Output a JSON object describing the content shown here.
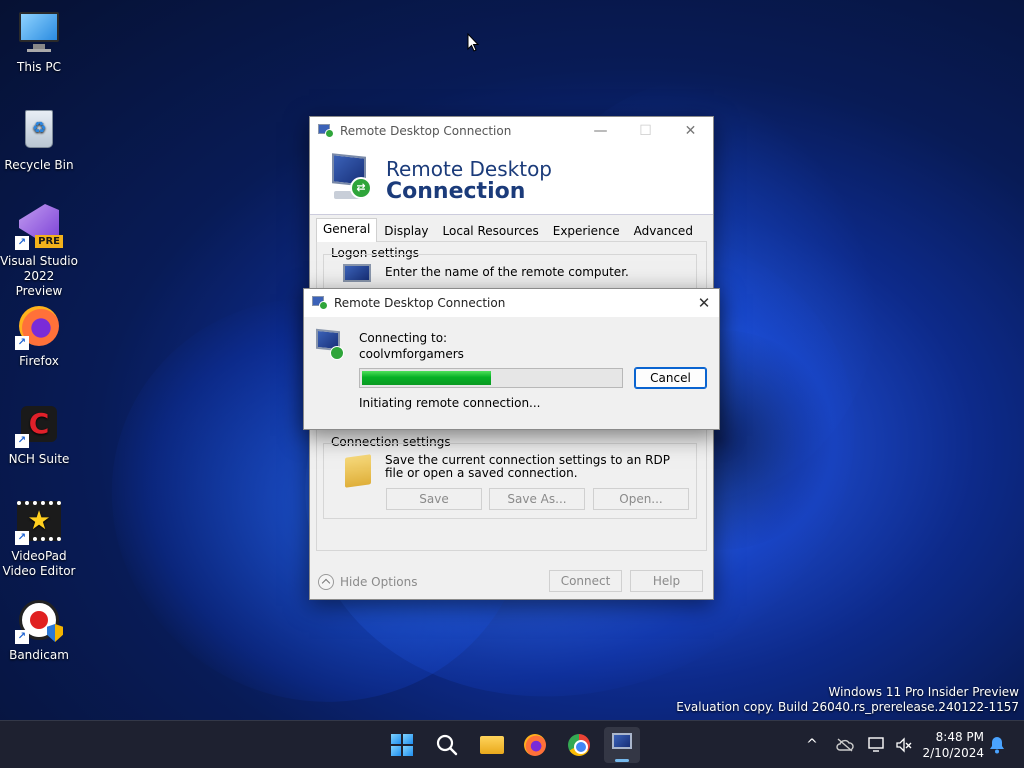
{
  "desktop": {
    "icons": [
      {
        "label": "This PC",
        "icon": "monitor-icon"
      },
      {
        "label": "Recycle Bin",
        "icon": "recycle-bin-icon"
      },
      {
        "label": "Visual Studio 2022 Preview",
        "icon": "visual-studio-icon",
        "badge": "PRE"
      },
      {
        "label": "Firefox",
        "icon": "firefox-icon"
      },
      {
        "label": "NCH Suite",
        "icon": "nch-icon",
        "glyph": "C"
      },
      {
        "label": "VideoPad Video Editor",
        "icon": "videopad-icon",
        "glyph": "★"
      },
      {
        "label": "Bandicam",
        "icon": "bandicam-icon"
      }
    ],
    "watermark": {
      "line1": "Windows 11 Pro Insider Preview",
      "line2": "Evaluation copy. Build 26040.rs_prerelease.240122-1157"
    }
  },
  "main_window": {
    "title": "Remote Desktop Connection",
    "banner_line1": "Remote Desktop",
    "banner_line2": "Connection",
    "controls": {
      "minimize": "—",
      "maximize": "☐",
      "close": "✕"
    },
    "tabs": [
      {
        "label": "General",
        "active": true
      },
      {
        "label": "Display",
        "active": false
      },
      {
        "label": "Local Resources",
        "active": false
      },
      {
        "label": "Experience",
        "active": false
      },
      {
        "label": "Advanced",
        "active": false
      }
    ],
    "logon_settings": {
      "label": "Logon settings",
      "text": "Enter the name of the remote computer."
    },
    "connection_settings": {
      "label": "Connection settings",
      "text": "Save the current connection settings to an RDP file or open a saved connection.",
      "save": "Save",
      "save_as": "Save As...",
      "open": "Open..."
    },
    "hide_options": "Hide Options",
    "connect": "Connect",
    "help": "Help"
  },
  "connecting_dialog": {
    "title": "Remote Desktop Connection",
    "close": "✕",
    "connecting_to_label": "Connecting to:",
    "computer_name": "coolvmforgamers",
    "progress": 0.5,
    "status": "Initiating remote connection...",
    "cancel": "Cancel",
    "progress_color": "#06b025"
  },
  "taskbar": {
    "items": [
      {
        "name": "start-button",
        "icon": "windows-logo-icon"
      },
      {
        "name": "search-button",
        "icon": "search-icon"
      },
      {
        "name": "file-explorer-button",
        "icon": "folder-icon"
      },
      {
        "name": "firefox-taskbar-button",
        "icon": "firefox-icon"
      },
      {
        "name": "chrome-taskbar-button",
        "icon": "chrome-icon"
      },
      {
        "name": "rdc-taskbar-button",
        "icon": "remote-desktop-icon",
        "active": true
      }
    ],
    "tray": {
      "chevron": "^",
      "time": "8:48 PM",
      "date": "2/10/2024"
    }
  },
  "colors": {
    "accent": "#0a64d0",
    "banner_text": "#1b3b7a",
    "taskbar_bg": "#1e2130"
  }
}
